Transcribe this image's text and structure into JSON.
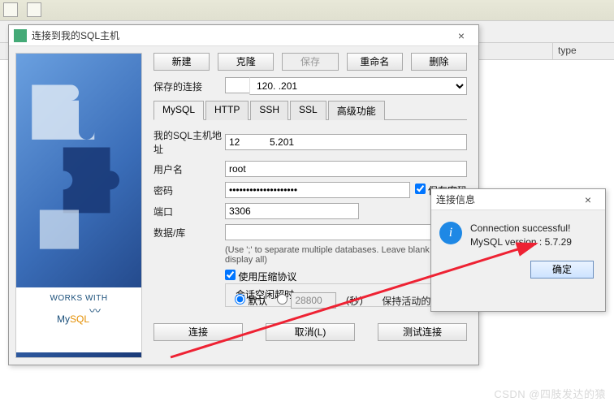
{
  "bg": {
    "col_type": "type"
  },
  "dialog": {
    "title": "连接到我的SQL主机",
    "buttons": {
      "new": "新建",
      "clone": "克隆",
      "save": "保存",
      "rename": "重命名",
      "delete": "删除"
    },
    "saved_label": "保存的连接",
    "saved_value": "120.         .201",
    "tabs": {
      "mysql": "MySQL",
      "http": "HTTP",
      "ssh": "SSH",
      "ssl": "SSL",
      "adv": "高级功能"
    },
    "fields": {
      "host_lbl": "我的SQL主机地址",
      "host_val": "12           5.201",
      "user_lbl": "用户名",
      "user_val": "root",
      "pwd_lbl": "密码",
      "pwd_val": "••••••••••••••••••••",
      "save_pwd": "保存密码",
      "port_lbl": "端口",
      "port_val": "3306",
      "db_lbl": "数据/库",
      "db_val": ""
    },
    "hint": "(Use ';' to separate multiple databases. Leave blank to display all)",
    "compress": "使用压缩协议",
    "idle_lbl": "会话空闲超时",
    "idle_default": "默认",
    "idle_val": "28800",
    "idle_unit": "（秒）",
    "keepalive_lbl": "保持活动的间隔",
    "bottom": {
      "connect": "连接",
      "cancel": "取消(L)",
      "test": "测试连接"
    }
  },
  "info": {
    "title": "连接信息",
    "line1": "Connection successful!",
    "line2": "MySQL version : 5.7.29",
    "ok": "确定"
  },
  "logo": {
    "works": "WORKS WITH",
    "my": "My",
    "sql": "SQL"
  },
  "watermark": "CSDN @四肢发达的猿"
}
